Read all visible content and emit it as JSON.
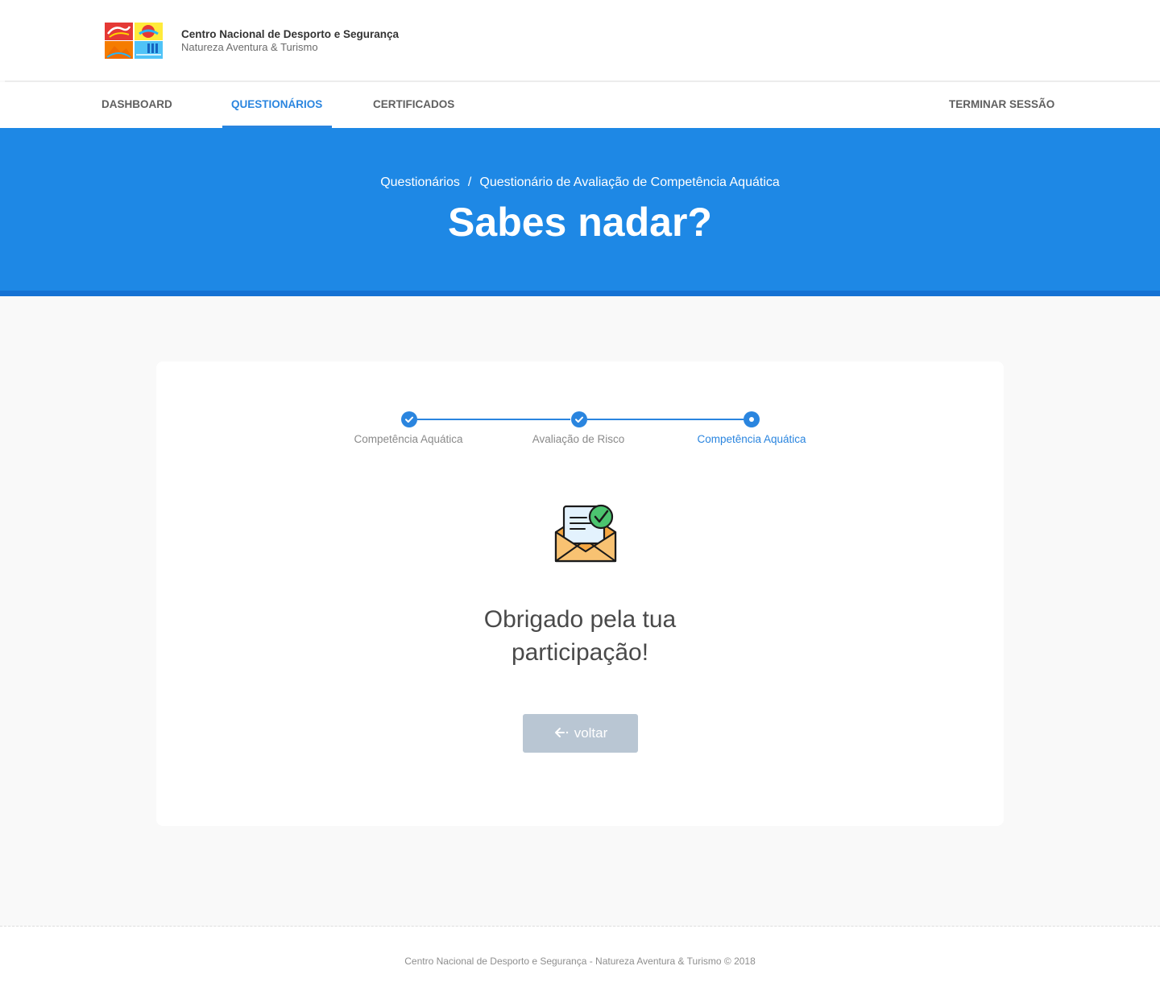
{
  "header": {
    "brand_title": "Centro Nacional de Desporto e Segurança",
    "brand_subtitle": "Natureza Aventura & Turismo"
  },
  "nav": {
    "items": [
      {
        "label": "DASHBOARD",
        "active": false
      },
      {
        "label": "QUESTIONÁRIOS",
        "active": true
      },
      {
        "label": "CERTIFICADOS",
        "active": false
      }
    ],
    "logout_label": "TERMINAR SESSÃO"
  },
  "hero": {
    "breadcrumb": [
      "Questionários",
      "/",
      "Questionário de Avaliação de Competência Aquática"
    ],
    "title": "Sabes nadar?"
  },
  "stepper": {
    "steps": [
      {
        "label": "Competência Aquática",
        "state": "done"
      },
      {
        "label": "Avaliação de Risco",
        "state": "done"
      },
      {
        "label": "Competência Aquática",
        "state": "current"
      }
    ]
  },
  "main": {
    "icon": "envelope-check-icon",
    "thanks_line1": "Obrigado pela tua",
    "thanks_line2": "participação!",
    "back_label": "voltar"
  },
  "footer": {
    "text": "Centro Nacional de Desporto e Segurança - Natureza Aventura & Turismo © 2018"
  },
  "colors": {
    "primary": "#1e88e5",
    "accent": "#2a85df",
    "button_disabled": "#b9c6d3"
  }
}
